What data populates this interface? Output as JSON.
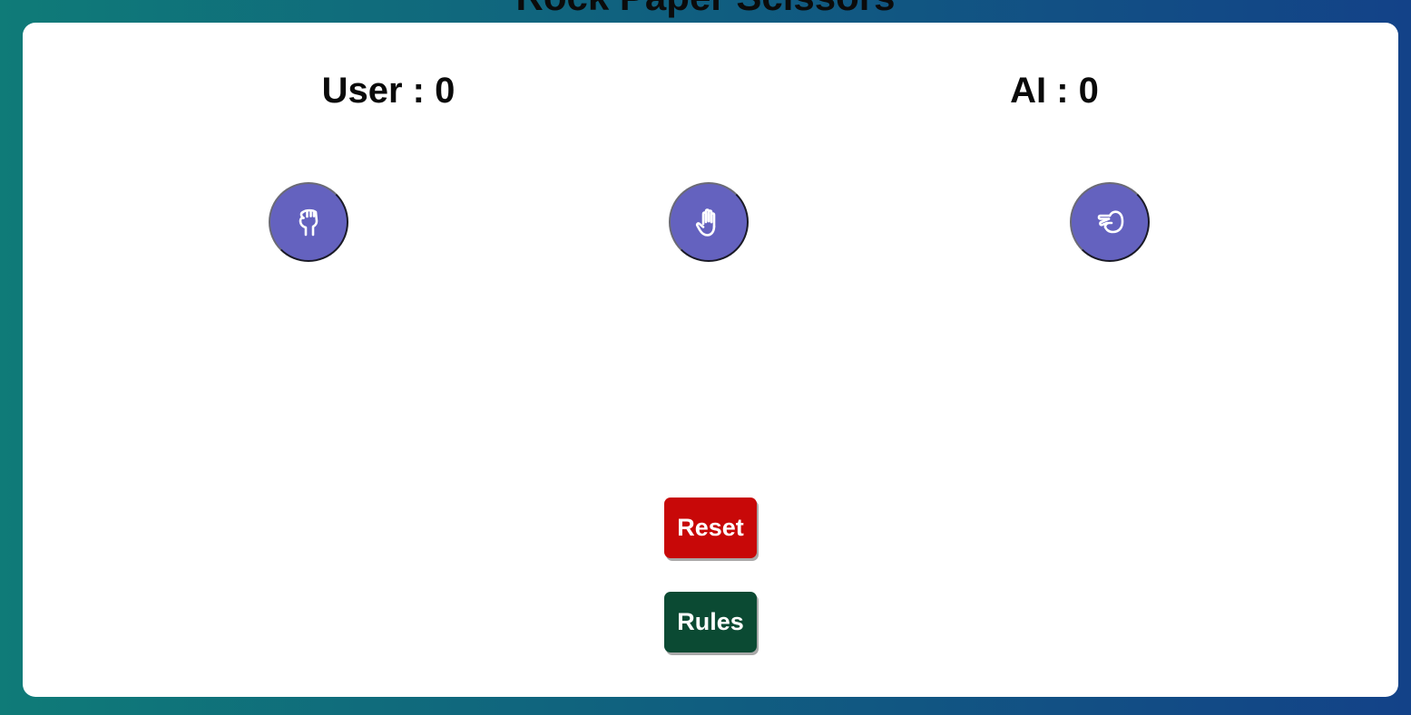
{
  "header": {
    "title": "Rock Paper Scissors"
  },
  "scoreboard": {
    "user_label": "User : 0",
    "ai_label": "AI : 0",
    "user_score": 0,
    "ai_score": 0
  },
  "choices": [
    {
      "id": "rock",
      "icon": "fist-icon"
    },
    {
      "id": "paper",
      "icon": "open-hand-icon"
    },
    {
      "id": "scissors",
      "icon": "scissors-hand-icon"
    }
  ],
  "actions": {
    "reset_label": "Reset",
    "rules_label": "Rules"
  },
  "colors": {
    "background_start": "#0f7b78",
    "background_end": "#134288",
    "card": "#ffffff",
    "choice_button": "#6462bf",
    "reset_button": "#c80808",
    "rules_button": "#0b4a33"
  }
}
